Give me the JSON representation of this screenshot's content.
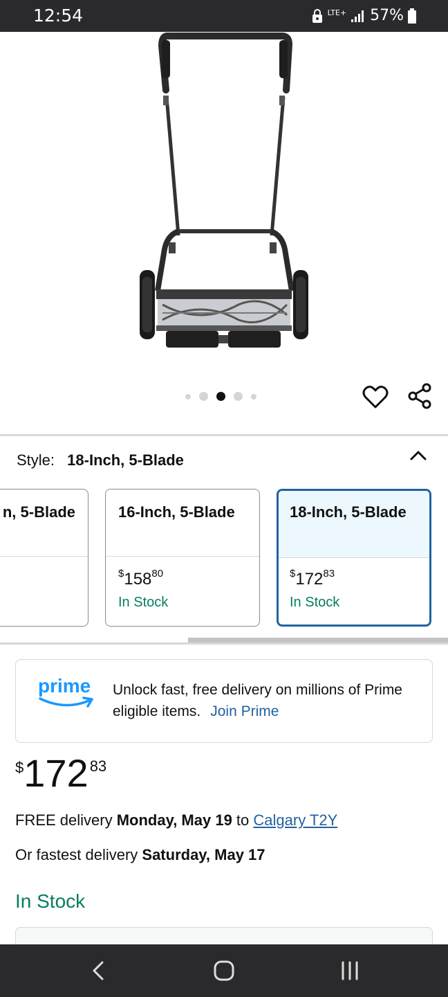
{
  "status_bar": {
    "time": "12:54",
    "network": "LTE+",
    "battery": "57%"
  },
  "carousel": {
    "total": 5,
    "active_index": 2
  },
  "style": {
    "label": "Style:",
    "value": "18-Inch, 5-Blade"
  },
  "variants": [
    {
      "title": "n, 5-Blade",
      "price_whole": "",
      "price_frac": "",
      "stock": ""
    },
    {
      "title": "16-Inch, 5-Blade",
      "price_symbol": "$",
      "price_whole": "158",
      "price_frac": "80",
      "stock": "In Stock"
    },
    {
      "title": "18-Inch, 5-Blade",
      "price_symbol": "$",
      "price_whole": "172",
      "price_frac": "83",
      "stock": "In Stock",
      "selected": true
    }
  ],
  "prime": {
    "logo_text": "prime",
    "message": "Unlock fast, free delivery on millions of Prime eligible items.",
    "join_label": "Join Prime"
  },
  "price": {
    "symbol": "$",
    "whole": "172",
    "fraction": "83"
  },
  "delivery": {
    "prefix": "FREE delivery ",
    "date": "Monday, May 19",
    "to": " to ",
    "location": "Calgary T2Y"
  },
  "fastest": {
    "prefix": "Or fastest delivery ",
    "date": "Saturday, May 17"
  },
  "availability": "In Stock",
  "colors": {
    "link": "#2162a1",
    "in_stock": "#067d62",
    "prime_blue": "#1a98ff",
    "selected_border": "#2162a1"
  }
}
